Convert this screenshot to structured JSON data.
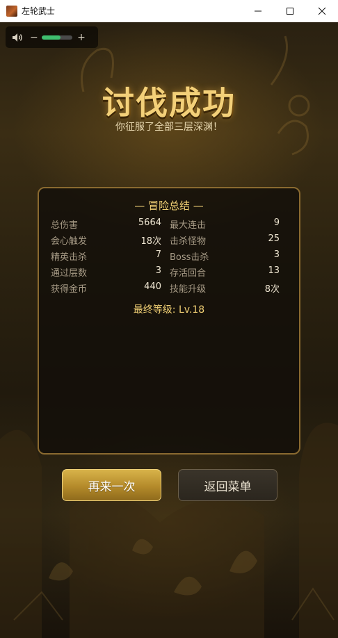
{
  "window": {
    "title": "左轮武士"
  },
  "volume": {
    "minus_label": "−",
    "plus_label": "+",
    "level": 0.62,
    "fill_color": "#3fbf6f"
  },
  "result": {
    "title": "讨伐成功",
    "subtitle": "你征服了全部三层深渊！"
  },
  "summary": {
    "title": "— 冒险总结 —",
    "stats": [
      {
        "label": "总伤害",
        "value": "5664"
      },
      {
        "label": "最大连击",
        "value": "9"
      },
      {
        "label": "会心触发",
        "value": "18次"
      },
      {
        "label": "击杀怪物",
        "value": "25"
      },
      {
        "label": "精英击杀",
        "value": "7"
      },
      {
        "label": "Boss击杀",
        "value": "3"
      },
      {
        "label": "通过层数",
        "value": "3"
      },
      {
        "label": "存活回合",
        "value": "13"
      },
      {
        "label": "获得金币",
        "value": "440"
      },
      {
        "label": "技能升级",
        "value": "8次"
      }
    ],
    "final_level": "最终等级: Lv.18"
  },
  "buttons": {
    "retry_label": "再来一次",
    "menu_label": "返回菜单"
  },
  "colors": {
    "accent_gold": "#f0cf74",
    "panel_border": "#8a6a30",
    "retry_button": "#c49a34",
    "menu_button": "#2f2a22"
  },
  "icons": {
    "app": "game-app-icon",
    "speaker": "speaker-icon"
  }
}
